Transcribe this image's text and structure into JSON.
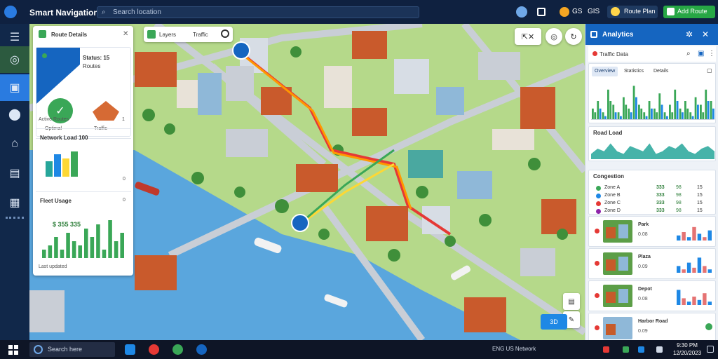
{
  "app": {
    "title": "Smart Navigation",
    "search_placeholder": "Search location"
  },
  "topbar": {
    "user_short": "GS",
    "user_name": "GIS",
    "chip_label": "Route Plan",
    "primary_button": "Add Route"
  },
  "map_toolbar": {
    "label1": "Layers",
    "label2": "Traffic"
  },
  "map_controls": {
    "share_label": "⇱",
    "close_label": "✕",
    "locate_label": "◎",
    "refresh_label": "↻",
    "chip_label": "3D"
  },
  "left_card": {
    "title": "Route Details",
    "hero_title": "Status: 15",
    "hero_sub": "Routes",
    "label_left": "Optimal",
    "label_right": "Traffic",
    "row_a": "Active Routes",
    "row_a_count": "1",
    "section1_title": "Network Load 100",
    "section1_count": "0",
    "section2_title": "Fleet Usage",
    "section2_count": "0",
    "big_value": "$ 355 335",
    "footer": "Last updated"
  },
  "right_panel": {
    "title": "Analytics",
    "sub_label": "Traffic Data",
    "tabs": [
      "Overview",
      "Statistics",
      "Details"
    ],
    "card2_title": "Road Load",
    "card3_title": "Congestion",
    "legend": [
      {
        "name": "Zone A",
        "v1": "333",
        "v2": "98",
        "v3": "15",
        "color": "#3aa757"
      },
      {
        "name": "Zone B",
        "v1": "333",
        "v2": "98",
        "v3": "15",
        "color": "#1e88e5"
      },
      {
        "name": "Zone C",
        "v1": "333",
        "v2": "98",
        "v3": "15",
        "color": "#e53935"
      },
      {
        "name": "Zone D",
        "v1": "333",
        "v2": "98",
        "v3": "15",
        "color": "#8e24aa"
      }
    ],
    "items": [
      {
        "title": "Park",
        "sub": "0.08"
      },
      {
        "title": "Plaza",
        "sub": "0.09"
      },
      {
        "title": "Depot",
        "sub": "0.08"
      },
      {
        "title": "Harbor Road",
        "sub": "0.09"
      }
    ]
  },
  "taskbar": {
    "search": "Search here",
    "tray_text": "ENG US  Network",
    "time": "9:30 PM",
    "date": "12/20/2023"
  },
  "colors": {
    "accent": "#1565c0",
    "success": "#3aa757",
    "water": "#5aa6dd",
    "route_red": "#e53935",
    "route_orange": "#ff9800",
    "route_yellow": "#fdd835"
  },
  "chart_data": [
    {
      "type": "bar",
      "title": "",
      "categories": [
        "1",
        "2",
        "3",
        "4",
        "5",
        "6",
        "7",
        "8",
        "9",
        "10",
        "11",
        "12",
        "13",
        "14",
        "15",
        "16",
        "17",
        "18",
        "19",
        "20",
        "21",
        "22",
        "23",
        "24"
      ],
      "series": [
        {
          "values": [
            3,
            5,
            2,
            8,
            4,
            2,
            6,
            3,
            9,
            4,
            2,
            5,
            3,
            7,
            2,
            4,
            8,
            3,
            5,
            2,
            6,
            4,
            8,
            5
          ]
        },
        {
          "values": [
            2,
            3,
            1,
            5,
            2,
            1,
            4,
            2,
            6,
            3,
            1,
            3,
            2,
            4,
            1,
            2,
            5,
            2,
            3,
            1,
            4,
            2,
            5,
            3
          ]
        }
      ],
      "ylim": [
        0,
        10
      ]
    },
    {
      "type": "area",
      "title": "Road Load",
      "x": [
        1,
        2,
        3,
        4,
        5,
        6,
        7,
        8,
        9,
        10,
        11,
        12,
        13,
        14,
        15,
        16,
        17,
        18,
        19,
        20
      ],
      "series": [
        {
          "values": [
            2,
            4,
            3,
            6,
            3,
            2,
            5,
            4,
            3,
            6,
            2,
            3,
            5,
            4,
            6,
            3,
            2,
            4,
            5,
            3
          ]
        }
      ],
      "ylim": [
        0,
        8
      ]
    },
    {
      "type": "bar",
      "title": "",
      "categories": [
        "1",
        "2",
        "3",
        "4",
        "5",
        "6",
        "7",
        "8",
        "9",
        "10",
        "11",
        "12",
        "13",
        "14"
      ],
      "series": [
        {
          "values": [
            2,
            3,
            5,
            2,
            6,
            4,
            3,
            7,
            5,
            8,
            2,
            9,
            4,
            6
          ]
        }
      ],
      "ylim": [
        0,
        10
      ]
    }
  ]
}
